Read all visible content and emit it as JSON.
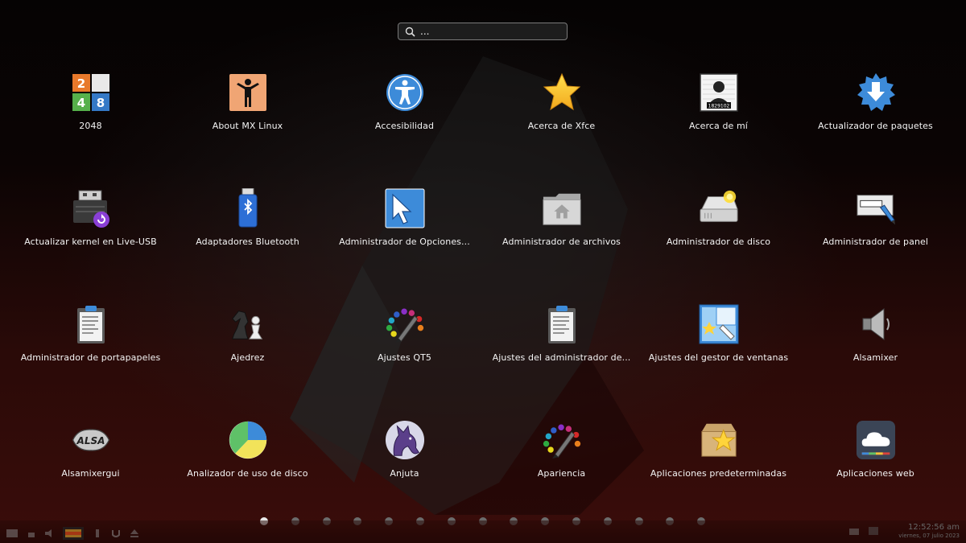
{
  "search": {
    "placeholder": "..."
  },
  "apps": [
    [
      {
        "label": "2048",
        "icon": "2048-game-icon"
      },
      {
        "label": "About MX Linux",
        "icon": "mx-linux-person-icon"
      },
      {
        "label": "Accesibilidad",
        "icon": "accessibility-icon"
      },
      {
        "label": "Acerca de Xfce",
        "icon": "star-icon"
      },
      {
        "label": "Acerca de mí",
        "icon": "user-mugshot-icon"
      },
      {
        "label": "Actualizador de paquetes",
        "icon": "package-updater-icon"
      }
    ],
    [
      {
        "label": "Actualizar kernel en Live-USB",
        "icon": "usb-kernel-update-icon"
      },
      {
        "label": "Adaptadores Bluetooth",
        "icon": "bluetooth-usb-icon"
      },
      {
        "label": "Administrador de Opciones...",
        "icon": "cursor-settings-icon"
      },
      {
        "label": "Administrador de archivos",
        "icon": "home-folder-icon"
      },
      {
        "label": "Administrador de disco",
        "icon": "disk-drive-icon"
      },
      {
        "label": "Administrador de panel",
        "icon": "panel-edit-icon"
      }
    ],
    [
      {
        "label": "Administrador de portapapeles",
        "icon": "clipboard-icon"
      },
      {
        "label": "Ajedrez",
        "icon": "chess-icon"
      },
      {
        "label": "Ajustes QT5",
        "icon": "color-palette-icon"
      },
      {
        "label": "Ajustes del administrador de...",
        "icon": "clipboard-settings-icon"
      },
      {
        "label": "Ajustes del gestor de ventanas",
        "icon": "window-manager-icon"
      },
      {
        "label": "Alsamixer",
        "icon": "speaker-icon"
      }
    ],
    [
      {
        "label": "Alsamixergui",
        "icon": "alsa-logo-icon"
      },
      {
        "label": "Analizador de uso de disco",
        "icon": "pie-chart-icon"
      },
      {
        "label": "Anjuta",
        "icon": "anjuta-horse-icon"
      },
      {
        "label": "Apariencia",
        "icon": "appearance-palette-icon"
      },
      {
        "label": "Aplicaciones predeterminadas",
        "icon": "default-apps-box-icon"
      },
      {
        "label": "Aplicaciones web",
        "icon": "web-cloud-icon"
      }
    ]
  ],
  "pagination": {
    "pages": 15,
    "current": 1
  },
  "panel": {
    "time": "12:52:56 am",
    "date": "viernes, 07 julio 2023"
  },
  "colors": {
    "accent_blue": "#3d8bd9",
    "background_red": "#3a0d0a"
  }
}
